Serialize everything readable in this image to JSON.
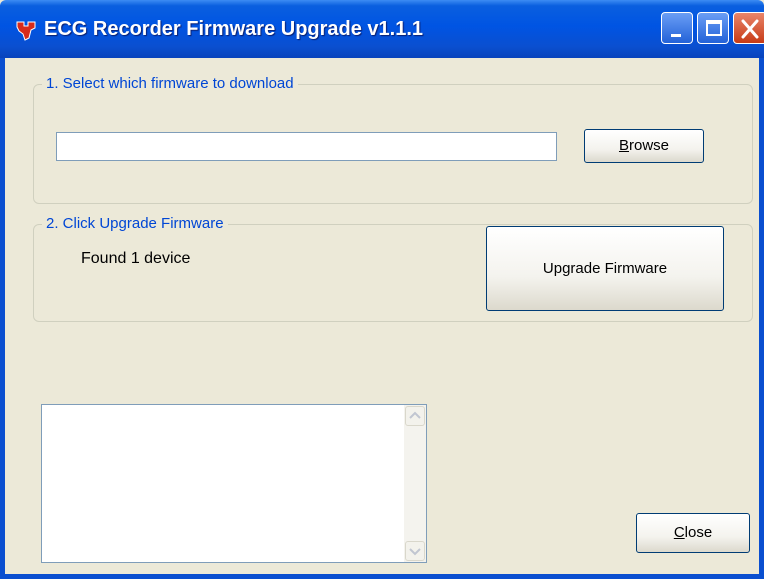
{
  "window": {
    "title": "ECG Recorder Firmware Upgrade v1.1.1",
    "icon": "ti-logo-icon",
    "controls": [
      "minimize-icon",
      "maximize-icon",
      "close-icon"
    ]
  },
  "step1": {
    "label": "1. Select which firmware to download",
    "file_path": "",
    "browse_prefix": "",
    "browse_mnemonic": "B",
    "browse_rest": "rowse"
  },
  "step2": {
    "label": "2. Click Upgrade Firmware",
    "status": "Found 1 device",
    "upgrade_label": "Upgrade Firmware"
  },
  "log": {
    "text": ""
  },
  "footer": {
    "close_mnemonic": "C",
    "close_rest": "lose"
  },
  "colors": {
    "titlebar": "#0054e3",
    "group_label": "#0046d5",
    "close_button": "#c73b16",
    "background": "#ece9d8"
  }
}
